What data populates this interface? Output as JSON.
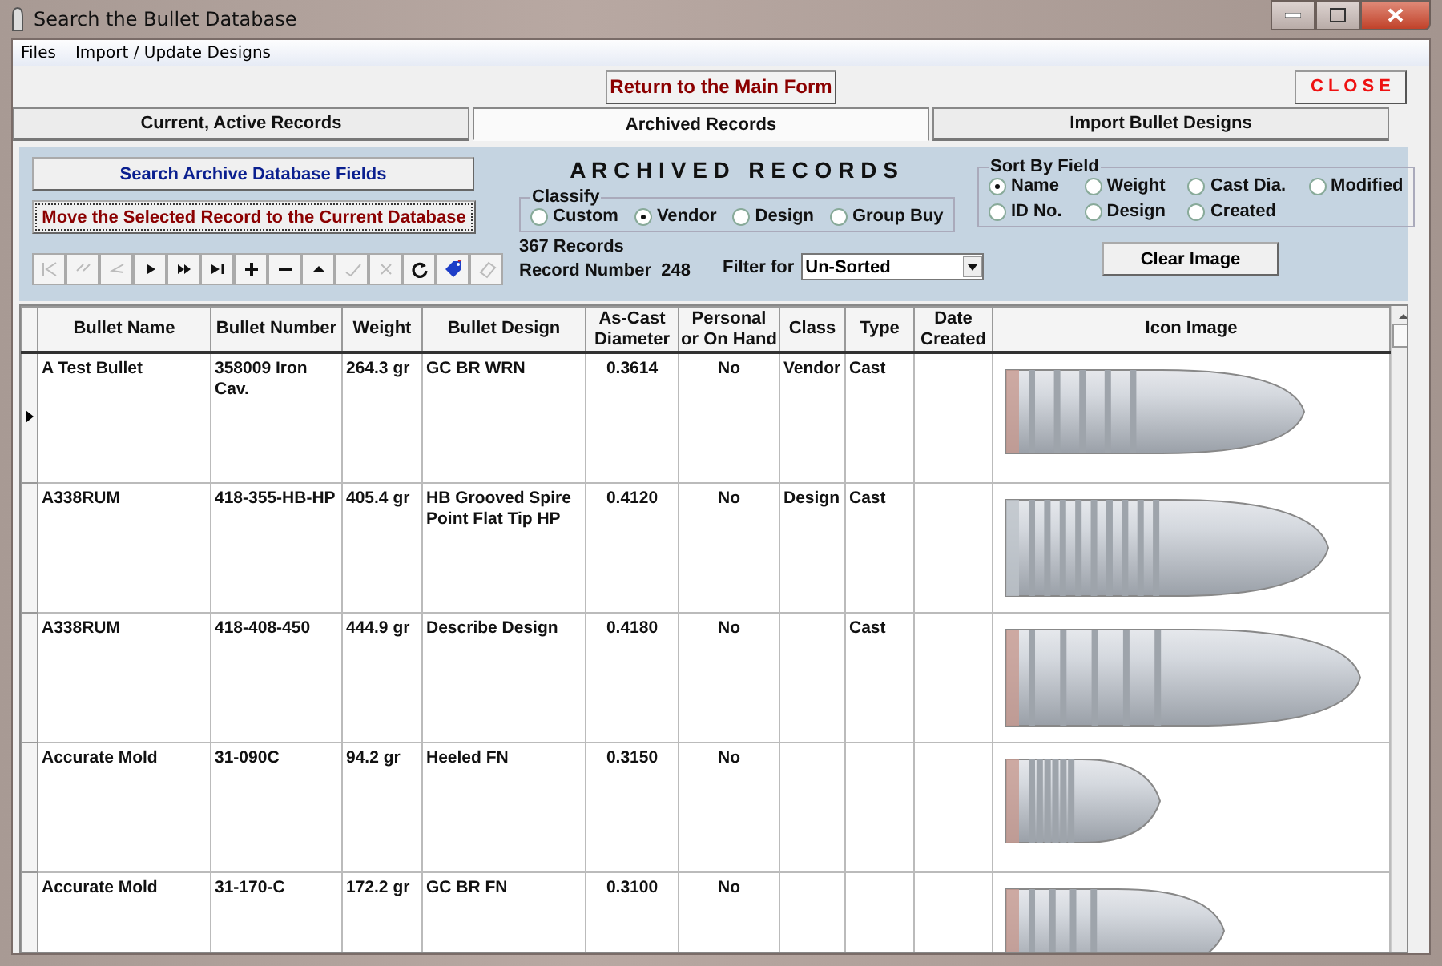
{
  "window": {
    "title": "Search the Bullet Database"
  },
  "menu": [
    "Files",
    "Import / Update Designs"
  ],
  "top_buttons": {
    "return": "Return to the Main Form",
    "close": "C L O S E"
  },
  "tabs": [
    {
      "label": "Current, Active Records",
      "selected": false
    },
    {
      "label": "Archived Records",
      "selected": true
    },
    {
      "label": "Import Bullet Designs",
      "selected": false
    }
  ],
  "panel": {
    "search_button": "Search Archive Database Fields",
    "move_button": "Move the Selected Record to the Current Database",
    "heading": "A R C H I V E D   R E C O R D S",
    "classify": {
      "title": "Classify",
      "options": [
        {
          "label": "Custom",
          "selected": false
        },
        {
          "label": "Vendor",
          "selected": true
        },
        {
          "label": "Design",
          "selected": false
        },
        {
          "label": "Group Buy",
          "selected": false
        }
      ]
    },
    "sort": {
      "title": "Sort By Field",
      "options": [
        {
          "label": "Name",
          "selected": true
        },
        {
          "label": "Weight",
          "selected": false
        },
        {
          "label": "Cast Dia.",
          "selected": false
        },
        {
          "label": "Modified",
          "selected": false
        },
        {
          "label": "ID No.",
          "selected": false
        },
        {
          "label": "Design",
          "selected": false
        },
        {
          "label": "Created",
          "selected": false
        }
      ]
    },
    "nav_buttons": [
      {
        "kind": "first",
        "disabled": true
      },
      {
        "kind": "prev_page",
        "disabled": true
      },
      {
        "kind": "prev",
        "disabled": true
      },
      {
        "kind": "next",
        "disabled": false
      },
      {
        "kind": "next_page",
        "disabled": false
      },
      {
        "kind": "last",
        "disabled": false
      },
      {
        "kind": "add",
        "disabled": false
      },
      {
        "kind": "delete",
        "disabled": false
      },
      {
        "kind": "up",
        "disabled": false
      },
      {
        "kind": "save",
        "disabled": true
      },
      {
        "kind": "cancel",
        "disabled": true
      },
      {
        "kind": "refresh",
        "disabled": false
      },
      {
        "kind": "tag",
        "disabled": false
      },
      {
        "kind": "eraser",
        "disabled": true
      }
    ],
    "record_count": "367 Records",
    "record_number_label": "Record Number",
    "record_number": "248",
    "filter_label": "Filter for",
    "filter_value": "Un-Sorted",
    "clear_button": "Clear Image"
  },
  "table": {
    "columns": [
      "Bullet Name",
      "Bullet Number",
      "Weight",
      "Bullet Design",
      "As-Cast Diameter",
      "Personal or On Hand",
      "Class",
      "Type",
      "Date Created",
      "Icon Image"
    ],
    "rows": [
      {
        "selected": true,
        "cells": [
          "A Test Bullet",
          "358009 Iron Cav.",
          "264.3 gr",
          "GC BR WRN",
          "0.3614",
          "No",
          "Vendor",
          "Cast",
          ""
        ]
      },
      {
        "selected": false,
        "cells": [
          "A338RUM",
          "418-355-HB-HP",
          "405.4 gr",
          "HB Grooved Spire Point Flat Tip HP",
          "0.4120",
          "No",
          "Design",
          "Cast",
          ""
        ]
      },
      {
        "selected": false,
        "cells": [
          "A338RUM",
          "418-408-450",
          "444.9 gr",
          "Describe Design",
          "0.4180",
          "No",
          "",
          "Cast",
          ""
        ]
      },
      {
        "selected": false,
        "cells": [
          "Accurate Mold",
          "31-090C",
          "94.2 gr",
          "Heeled FN",
          "0.3150",
          "No",
          "",
          "",
          ""
        ]
      },
      {
        "selected": false,
        "cells": [
          "Accurate Mold",
          "31-170-C",
          "172.2 gr",
          "GC BR FN",
          "0.3100",
          "No",
          "",
          "",
          ""
        ]
      }
    ]
  }
}
